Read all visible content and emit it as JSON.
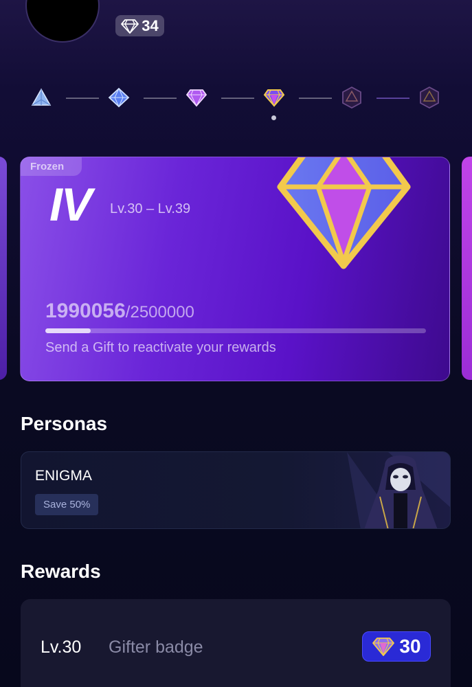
{
  "header": {
    "level_chip": "34"
  },
  "tiers": {
    "icons": [
      "tier-1-icon",
      "tier-2-icon",
      "tier-3-icon",
      "tier-4-icon",
      "tier-5-locked-icon",
      "tier-6-locked-icon"
    ],
    "current_index": 3
  },
  "tier_card": {
    "status_tag": "Frozen",
    "numeral": "IV",
    "level_range": "Lv.30 – Lv.39",
    "progress_current": "1990056",
    "progress_total": "/2500000",
    "progress_fraction": 0.12,
    "message": "Send a Gift to reactivate your rewards"
  },
  "personas": {
    "title": "Personas",
    "item": {
      "name": "ENIGMA",
      "badge": "Save 50%"
    }
  },
  "rewards": {
    "title": "Rewards",
    "item": {
      "level": "Lv.30",
      "name": "Gifter badge",
      "badge_level": "30"
    }
  },
  "colors": {
    "card_purple": "#6a25d8",
    "badge_blue": "#2a2ad6",
    "gem_gold": "#f2c94c"
  }
}
